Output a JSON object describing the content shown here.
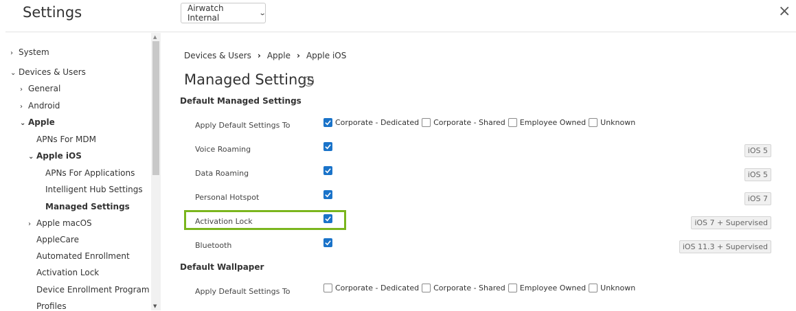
{
  "header": {
    "title": "Settings",
    "org_selector": "Airwatch Internal",
    "close_glyph": "×"
  },
  "sidebar": {
    "items": [
      {
        "label": "System",
        "caret": "›"
      },
      {
        "label": "Devices & Users",
        "caret": "⌄"
      },
      {
        "label": "General",
        "caret": "›"
      },
      {
        "label": "Android",
        "caret": "›"
      },
      {
        "label": "Apple",
        "caret": "⌄"
      },
      {
        "label": "APNs For MDM"
      },
      {
        "label": "Apple iOS",
        "caret": "⌄"
      },
      {
        "label": "APNs For Applications"
      },
      {
        "label": "Intelligent Hub Settings"
      },
      {
        "label": "Managed Settings"
      },
      {
        "label": "Apple macOS",
        "caret": "›"
      },
      {
        "label": "AppleCare"
      },
      {
        "label": "Automated Enrollment"
      },
      {
        "label": "Activation Lock"
      },
      {
        "label": "Device Enrollment Program"
      },
      {
        "label": "Profiles"
      }
    ],
    "selected": "Managed Settings"
  },
  "breadcrumb": [
    "Devices & Users",
    "Apple",
    "Apple iOS"
  ],
  "page_title": "Managed Settings",
  "sections": {
    "default_managed": "Default Managed Settings",
    "default_wallpaper": "Default Wallpaper"
  },
  "apply_default": {
    "label": "Apply Default Settings To",
    "options": [
      "Corporate - Dedicated",
      "Corporate - Shared",
      "Employee Owned",
      "Unknown"
    ],
    "checked": [
      true,
      false,
      false,
      false
    ]
  },
  "settings": [
    {
      "label": "Voice Roaming",
      "checked": true,
      "tag": "iOS 5"
    },
    {
      "label": "Data Roaming",
      "checked": true,
      "tag": "iOS 5"
    },
    {
      "label": "Personal Hotspot",
      "checked": true,
      "tag": "iOS 7"
    },
    {
      "label": "Activation Lock",
      "checked": true,
      "tag": "iOS 7 + Supervised"
    },
    {
      "label": "Bluetooth",
      "checked": true,
      "tag": "iOS 11.3 + Supervised"
    }
  ],
  "wallpaper_apply": {
    "label": "Apply Default Settings To",
    "options": [
      "Corporate - Dedicated",
      "Corporate - Shared",
      "Employee Owned",
      "Unknown"
    ],
    "checked": [
      false,
      false,
      false,
      false
    ]
  },
  "colors": {
    "checkbox": "#1a73c9",
    "highlight": "#7ab51d"
  }
}
